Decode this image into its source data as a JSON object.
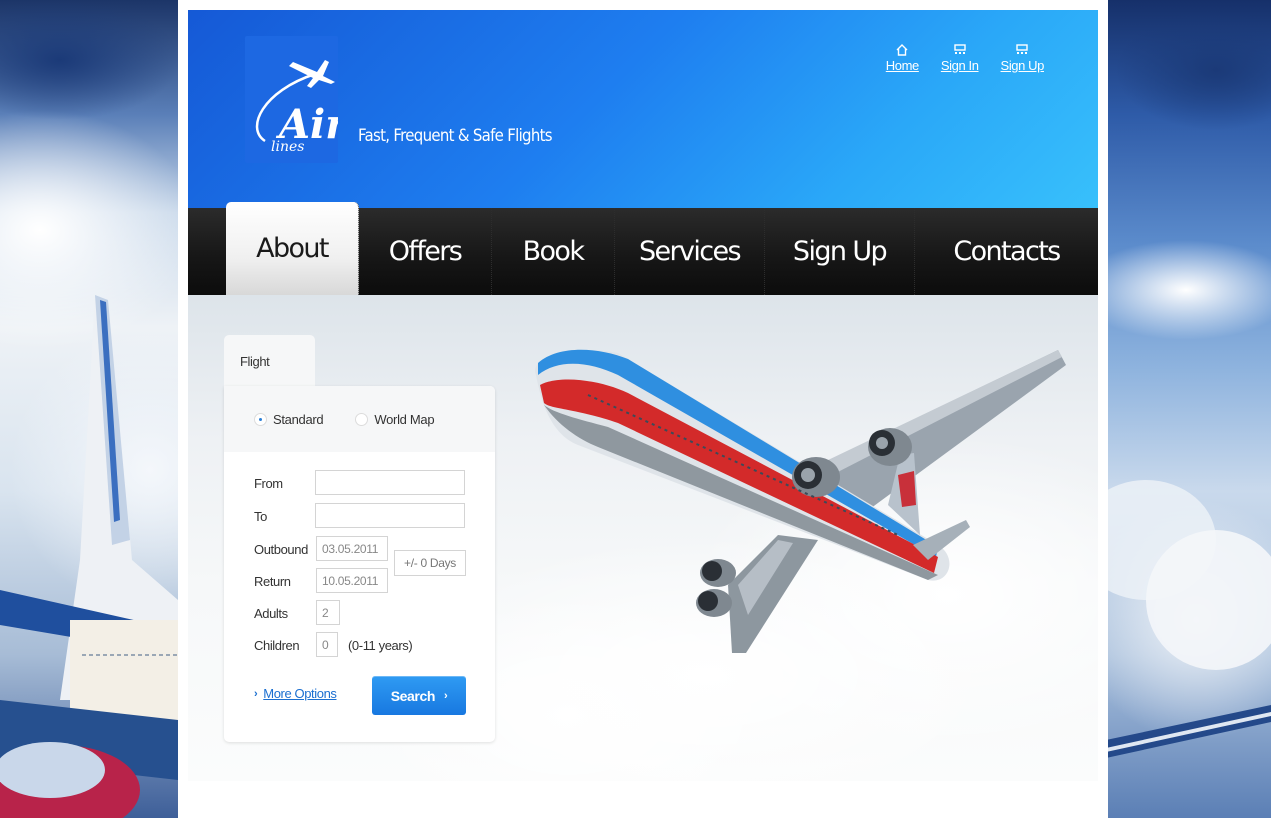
{
  "brand": {
    "logo_text": "Air",
    "logo_subtext": "lines",
    "tagline": "Fast, Frequent & Safe Flights"
  },
  "toplinks": [
    {
      "label": "Home",
      "icon": "home-icon"
    },
    {
      "label": "Sign In",
      "icon": "signin-icon"
    },
    {
      "label": "Sign Up",
      "icon": "signup-icon"
    }
  ],
  "nav": [
    {
      "label": "About",
      "active": true
    },
    {
      "label": "Offers"
    },
    {
      "label": "Book"
    },
    {
      "label": "Services"
    },
    {
      "label": "Sign Up"
    },
    {
      "label": "Contacts"
    }
  ],
  "flight_form": {
    "tab": "Flight",
    "mode_options": [
      {
        "label": "Standard",
        "selected": true
      },
      {
        "label": "World Map",
        "selected": false
      }
    ],
    "from_label": "From",
    "from_value": "",
    "to_label": "To",
    "to_value": "",
    "outbound_label": "Outbound",
    "outbound_value": "03.05.2011",
    "return_label": "Return",
    "return_value": "10.05.2011",
    "flex_days": "+/- 0 Days",
    "adults_label": "Adults",
    "adults_value": "2",
    "children_label": "Children",
    "children_value": "0",
    "children_note": "(0-11 years)",
    "more_options": "More Options",
    "search_button": "Search"
  },
  "colors": {
    "header_blue": "#1e7ef0",
    "nav_black": "#171717",
    "link_blue": "#1b6fd0",
    "button_blue": "#1878e0"
  }
}
